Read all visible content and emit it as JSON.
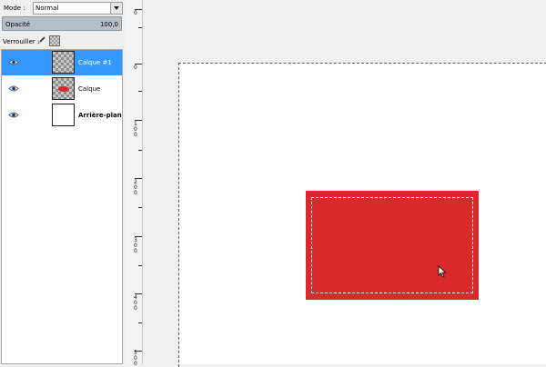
{
  "layers_dialog": {
    "mode_label": "Mode :",
    "mode_value": "Normal",
    "opacity_label": "Opacité",
    "opacity_value": "100,0",
    "lock_label": "Verrouiller :",
    "layers": [
      {
        "name": "Calque #1",
        "selected": true,
        "thumb": "checker"
      },
      {
        "name": "Calque",
        "selected": false,
        "thumb": "checker-red"
      },
      {
        "name": "Arrière-plan",
        "selected": false,
        "thumb": "white"
      }
    ]
  },
  "ruler": {
    "labels": [
      "0",
      "0",
      "1 0 0",
      "2 0 0",
      "3 0 0",
      "4 0 0",
      "5 0 0"
    ]
  },
  "colors": {
    "selected_row": "#3399ff",
    "shape_red": "#d8292b",
    "opacity_bar": "#b4bfc8"
  }
}
